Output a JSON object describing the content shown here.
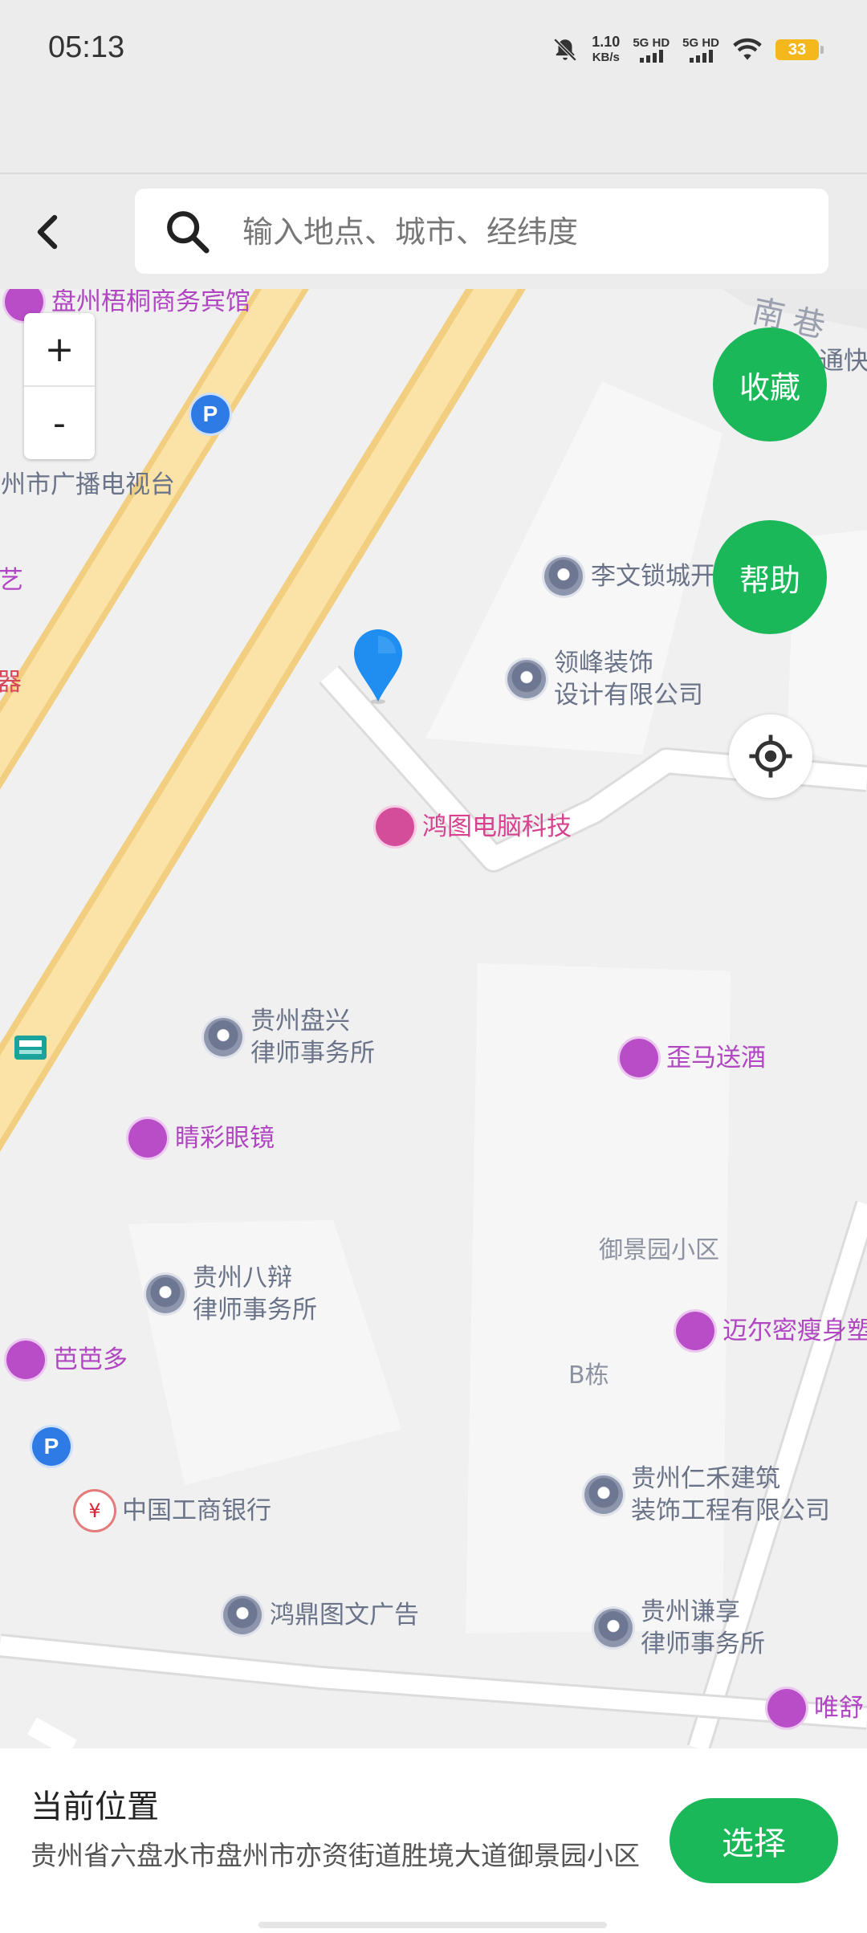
{
  "status_bar": {
    "time": "05:13",
    "speed_value": "1.10",
    "speed_unit": "KB/s",
    "sim1": "5G HD",
    "sim2": "5G HD",
    "battery": "33",
    "icons": [
      "mute-icon",
      "signal-icon",
      "signal-icon",
      "wifi-icon",
      "battery-icon"
    ]
  },
  "header": {
    "back_icon": "chevron-left-icon",
    "search_icon": "search-icon",
    "search_placeholder": "输入地点、城市、经纬度"
  },
  "map": {
    "zoom_in": "+",
    "zoom_out": "-",
    "favorite_label": "收藏",
    "help_label": "帮助",
    "locate_icon": "target-icon",
    "pin_icon": "map-pin-icon",
    "pois": {
      "hotel": "盘州梧桐商务宾馆",
      "parking1": "P",
      "tv": "盘州市广播电视台",
      "yi": "艺",
      "qi": "器",
      "tongkuai": "通快",
      "lock": "李文锁城开",
      "lingfeng_1": "领峰装饰",
      "lingfeng_2": "设计有限公司",
      "hongtu": "鸿图电脑科技",
      "panxing_1": "贵州盘兴",
      "panxing_2": "律师事务所",
      "waima": "歪马送酒",
      "jingcai": "睛彩眼镜",
      "yujing": "御景园小区",
      "babian_1": "贵州八辩",
      "babian_2": "律师事务所",
      "maierm": "迈尔密瘦身塑",
      "babaduo": "芭芭多",
      "b_building": "B栋",
      "parking2": "P",
      "icbc": "中国工商银行",
      "renhe_1": "贵州仁禾建筑",
      "renhe_2": "装饰工程有限公司",
      "hongding": "鸿鼎图文广告",
      "qianxiang_1": "贵州谦享",
      "qianxiang_2": "律师事务所",
      "weishu": "唯舒"
    },
    "colors": {
      "main_road": "#fbe3a8",
      "road_edge": "#f2cf80",
      "accent_green": "#1bb85a"
    }
  },
  "bottom": {
    "title": "当前位置",
    "address": "贵州省六盘水市盘州市亦资街道胜境大道御景园小区",
    "select_label": "选择"
  }
}
